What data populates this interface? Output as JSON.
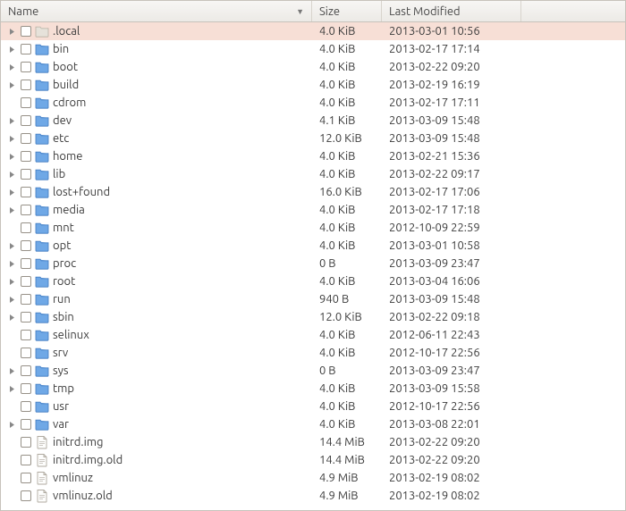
{
  "columns": {
    "name": "Name",
    "size": "Size",
    "modified": "Last Modified"
  },
  "icons": {
    "folder": "folder-icon",
    "folder_muted": "folder-muted-icon",
    "file": "file-icon"
  },
  "rows": [
    {
      "expandable": true,
      "type": "folder_muted",
      "name": ".local",
      "size": "4.0 KiB",
      "modified": "2013-03-01 10:56",
      "selected": true
    },
    {
      "expandable": true,
      "type": "folder",
      "name": "bin",
      "size": "4.0 KiB",
      "modified": "2013-02-17 17:14"
    },
    {
      "expandable": true,
      "type": "folder",
      "name": "boot",
      "size": "4.0 KiB",
      "modified": "2013-02-22 09:20"
    },
    {
      "expandable": true,
      "type": "folder",
      "name": "build",
      "size": "4.0 KiB",
      "modified": "2013-02-19 16:19"
    },
    {
      "expandable": false,
      "type": "folder",
      "name": "cdrom",
      "size": "4.0 KiB",
      "modified": "2013-02-17 17:11"
    },
    {
      "expandable": true,
      "type": "folder",
      "name": "dev",
      "size": "4.1 KiB",
      "modified": "2013-03-09 15:48"
    },
    {
      "expandable": true,
      "type": "folder",
      "name": "etc",
      "size": "12.0 KiB",
      "modified": "2013-03-09 15:48"
    },
    {
      "expandable": true,
      "type": "folder",
      "name": "home",
      "size": "4.0 KiB",
      "modified": "2013-02-21 15:36"
    },
    {
      "expandable": true,
      "type": "folder",
      "name": "lib",
      "size": "4.0 KiB",
      "modified": "2013-02-22 09:17"
    },
    {
      "expandable": true,
      "type": "folder",
      "name": "lost+found",
      "size": "16.0 KiB",
      "modified": "2013-02-17 17:06"
    },
    {
      "expandable": true,
      "type": "folder",
      "name": "media",
      "size": "4.0 KiB",
      "modified": "2013-02-17 17:18"
    },
    {
      "expandable": false,
      "type": "folder",
      "name": "mnt",
      "size": "4.0 KiB",
      "modified": "2012-10-09 22:59"
    },
    {
      "expandable": true,
      "type": "folder",
      "name": "opt",
      "size": "4.0 KiB",
      "modified": "2013-03-01 10:58"
    },
    {
      "expandable": true,
      "type": "folder",
      "name": "proc",
      "size": "0 B",
      "modified": "2013-03-09 23:47"
    },
    {
      "expandable": true,
      "type": "folder",
      "name": "root",
      "size": "4.0 KiB",
      "modified": "2013-03-04 16:06"
    },
    {
      "expandable": true,
      "type": "folder",
      "name": "run",
      "size": "940 B",
      "modified": "2013-03-09 15:48"
    },
    {
      "expandable": true,
      "type": "folder",
      "name": "sbin",
      "size": "12.0 KiB",
      "modified": "2013-02-22 09:18"
    },
    {
      "expandable": false,
      "type": "folder",
      "name": "selinux",
      "size": "4.0 KiB",
      "modified": "2012-06-11 22:43"
    },
    {
      "expandable": false,
      "type": "folder",
      "name": "srv",
      "size": "4.0 KiB",
      "modified": "2012-10-17 22:56"
    },
    {
      "expandable": true,
      "type": "folder",
      "name": "sys",
      "size": "0 B",
      "modified": "2013-03-09 23:47"
    },
    {
      "expandable": true,
      "type": "folder",
      "name": "tmp",
      "size": "4.0 KiB",
      "modified": "2013-03-09 15:58"
    },
    {
      "expandable": false,
      "type": "folder",
      "name": "usr",
      "size": "4.0 KiB",
      "modified": "2012-10-17 22:56"
    },
    {
      "expandable": true,
      "type": "folder",
      "name": "var",
      "size": "4.0 KiB",
      "modified": "2013-03-08 22:01"
    },
    {
      "expandable": false,
      "type": "file",
      "name": "initrd.img",
      "size": "14.4 MiB",
      "modified": "2013-02-22 09:20"
    },
    {
      "expandable": false,
      "type": "file",
      "name": "initrd.img.old",
      "size": "14.4 MiB",
      "modified": "2013-02-22 09:20"
    },
    {
      "expandable": false,
      "type": "file",
      "name": "vmlinuz",
      "size": "4.9 MiB",
      "modified": "2013-02-19 08:02"
    },
    {
      "expandable": false,
      "type": "file",
      "name": "vmlinuz.old",
      "size": "4.9 MiB",
      "modified": "2013-02-19 08:02"
    }
  ]
}
